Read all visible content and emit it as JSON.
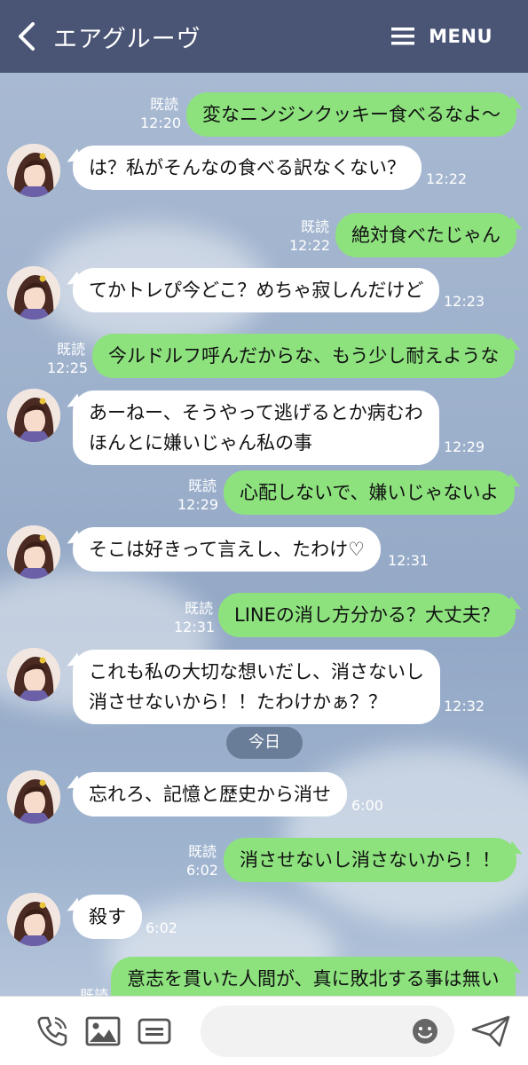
{
  "header": {
    "title": "エアグルーヴ",
    "menu_label": "MENU"
  },
  "read_label": "既読",
  "date_separator": "今日",
  "messages": [
    {
      "side": "right",
      "text": "変なニンジンクッキー食べるなよ～",
      "time": "12:20",
      "read": true
    },
    {
      "side": "left",
      "text": "は？私がそんなの食べる訳なくない？",
      "time": "12:22"
    },
    {
      "side": "right",
      "text": "絶対食べたじゃん",
      "time": "12:22",
      "read": true
    },
    {
      "side": "left",
      "text": "てかトレぴ今どこ？めちゃ寂しんだけど",
      "time": "12:23"
    },
    {
      "side": "right",
      "text": "今ルドルフ呼んだからな、もう少し耐えような",
      "time": "12:25",
      "read": true
    },
    {
      "side": "left",
      "lines": [
        "あーねー、そうやって逃げるとか病むわ",
        "ほんとに嫌いじゃん私の事"
      ],
      "time": "12:29"
    },
    {
      "side": "right",
      "text": "心配しないで、嫌いじゃないよ",
      "time": "12:29",
      "read": true
    },
    {
      "side": "left",
      "text": "そこは好きって言えし、たわけ♡",
      "time": "12:31"
    },
    {
      "side": "right",
      "text": "LINEの消し方分かる？大丈夫？",
      "time": "12:31",
      "read": true
    },
    {
      "side": "left",
      "lines": [
        "これも私の大切な想いだし、消さないし",
        "消させないから！！たわけかぁ？？"
      ],
      "time": "12:32"
    },
    {
      "side": "left",
      "text": "忘れろ、記憶と歴史から消せ",
      "time": "6:00"
    },
    {
      "side": "right",
      "text": "消させないし消さないから！！",
      "time": "6:02",
      "read": true
    },
    {
      "side": "left",
      "text": "殺す",
      "time": "6:02"
    },
    {
      "side": "right",
      "text": "意志を貫いた人間が、真に敗北する事は無い",
      "time": "",
      "read": true
    }
  ],
  "input": {
    "placeholder": ""
  },
  "colors": {
    "header_bg": "#4a5576",
    "bubble_sent": "#8de27e",
    "bubble_received": "#ffffff"
  },
  "icons": {
    "back": "chevron-left-icon",
    "menu": "hamburger-icon",
    "call": "phone-icon",
    "image": "image-icon",
    "chat_list": "list-icon",
    "emoji": "smiley-icon",
    "send": "send-icon"
  }
}
